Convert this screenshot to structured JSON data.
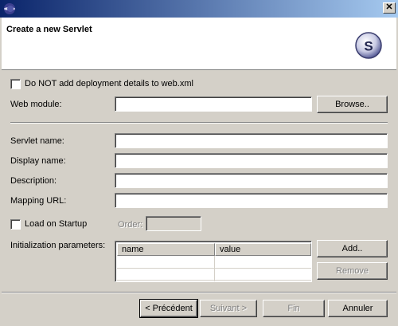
{
  "window": {
    "title": ""
  },
  "header": {
    "title": "Create a new Servlet",
    "icon_letter": "S"
  },
  "deployment": {
    "checkbox_label": "Do NOT add deployment details to web.xml",
    "checked": false
  },
  "web_module": {
    "label": "Web module:",
    "value": "",
    "browse_label": "Browse.."
  },
  "servlet_name": {
    "label": "Servlet name:",
    "value": ""
  },
  "display_name": {
    "label": "Display name:",
    "value": ""
  },
  "description": {
    "label": "Description:",
    "value": ""
  },
  "mapping_url": {
    "label": "Mapping URL:",
    "value": ""
  },
  "load_on_startup": {
    "label": "Load on Startup",
    "checked": false,
    "order_label": "Order:",
    "order_value": ""
  },
  "init_params": {
    "label": "Initialization parameters:",
    "columns": [
      "name",
      "value"
    ],
    "add_label": "Add..",
    "remove_label": "Remove"
  },
  "footer": {
    "back_label": "< Précédent",
    "next_label": "Suivant >",
    "finish_label": "Fin",
    "cancel_label": "Annuler"
  },
  "icons": {
    "app": "eclipse-icon",
    "close": "close-icon",
    "wizard": "servlet-wizard-icon"
  }
}
